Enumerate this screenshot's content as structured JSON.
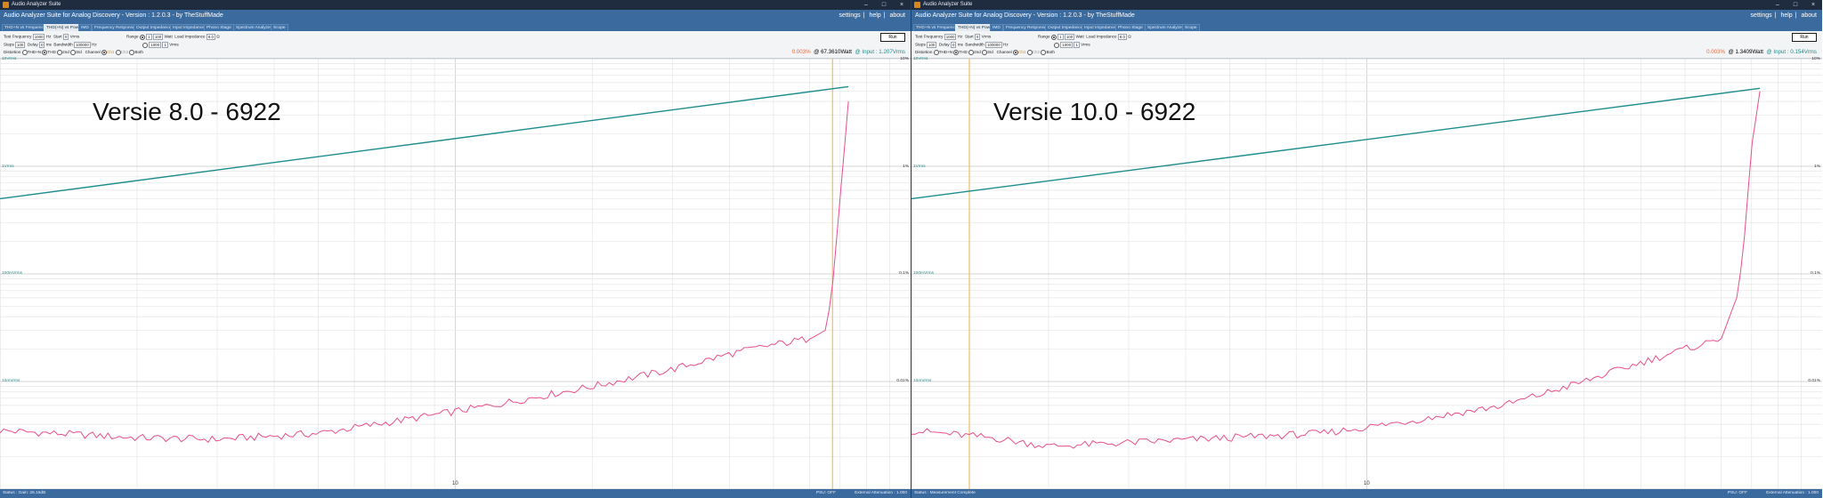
{
  "colors": {
    "titlebar": "#1f2c3f",
    "header": "#3a6a9e",
    "thd": "#e84f8c",
    "level": "#1f8c8c",
    "marker": "#f0b040"
  },
  "windows": [
    {
      "title": "Audio Analyzer Suite",
      "app_name": "Audio Analyzer Suite for Analog Discovery - Version : 1.2.0.3 - by TheStuffMade",
      "links": [
        "settings",
        "help",
        "about"
      ],
      "tabs": [
        "THD+N vs Frequency",
        "THD(+N) vs Power",
        "IMD",
        "Frequency Response",
        "Output Impedance",
        "Input Impedance",
        "Phono Stage",
        "Spectrum Analyzer",
        "Scope"
      ],
      "active_tab": 1,
      "controls": {
        "test_freq_label": "Test Frequency",
        "test_freq_value": "1000",
        "hz": "Hz",
        "start_label": "Start",
        "start_value": "0",
        "vrms": "Vrms",
        "range_label": "Range",
        "range_from": "1",
        "range_to": "100",
        "watt": "Watt",
        "load_label": "Load Impedance",
        "load_value": "8.0",
        "ohm": "Ω",
        "steps_label": "Steps",
        "steps_value": "100",
        "delay_label": "Delay",
        "delay_value": "0",
        "ms": "ms",
        "bandwidth_label": "Bandwidth",
        "bandwidth_value": "100000",
        "sub_from": "1000",
        "sub_to": "1",
        "sub_unit": "Vrms",
        "distortion_label": "Distortion",
        "dist_opts": [
          "THD+N",
          "THD",
          "2nd",
          "3rd"
        ],
        "channel_label": "Channel",
        "channel_opts": [
          "Ch1",
          "Ch2",
          "Both"
        ],
        "run": "Run"
      },
      "readout": {
        "thd": "0.003%",
        "power": "@ 67.3610Watt",
        "input": "@ Input : 1.207Vrms"
      },
      "version_label": "Versie 8.0 - 6922",
      "y_left": [
        "10Vrms",
        "1Vrms",
        "100mVrms",
        "10mVrms"
      ],
      "y_right": [
        "10%",
        "1%",
        "0.1%",
        "0.01%"
      ],
      "x_label": "10",
      "status_left": "Status : Gain: 26.15dB",
      "status_mid": "PSU: OFF",
      "status_right": "External Attenuation : 1.000"
    },
    {
      "title": "Audio Analyzer Suite",
      "app_name": "Audio Analyzer Suite for Analog Discovery - Version : 1.2.0.3 - by TheStuffMade",
      "links": [
        "settings",
        "help",
        "about"
      ],
      "tabs": [
        "THD+N vs Frequency",
        "THD(+N) vs Power",
        "IMD",
        "Frequency Response",
        "Output Impedance",
        "Input Impedance",
        "Phono Stage",
        "Spectrum Analyzer",
        "Scope"
      ],
      "active_tab": 1,
      "controls": {
        "test_freq_label": "Test Frequency",
        "test_freq_value": "1000",
        "hz": "Hz",
        "start_label": "Start",
        "start_value": "0",
        "vrms": "Vrms",
        "range_label": "Range",
        "range_from": "1",
        "range_to": "100",
        "watt": "Watt",
        "load_label": "Load Impedance",
        "load_value": "8.0",
        "ohm": "Ω",
        "steps_label": "Steps",
        "steps_value": "100",
        "delay_label": "Delay",
        "delay_value": "0",
        "ms": "ms",
        "bandwidth_label": "Bandwidth",
        "bandwidth_value": "100000",
        "sub_from": "1000",
        "sub_to": "1",
        "sub_unit": "Vrms",
        "distortion_label": "Distortion",
        "dist_opts": [
          "THD+N",
          "THD",
          "2nd",
          "3rd"
        ],
        "channel_label": "Channel",
        "channel_opts": [
          "Ch1",
          "Ch2",
          "Both"
        ],
        "run": "Run"
      },
      "readout": {
        "thd": "0.003%",
        "power": "@ 1.3409Watt",
        "input": "@ Input : 0.154Vrms"
      },
      "version_label": "Versie 10.0 - 6922",
      "y_left": [
        "10Vrms",
        "1Vrms",
        "100mVrms",
        "10mVrms"
      ],
      "y_right": [
        "10%",
        "1%",
        "0.1%",
        "0.01%"
      ],
      "x_label": "10",
      "status_left": "Status : Measurement Complete",
      "status_mid": "PSU: OFF",
      "status_right": "External Attenuation : 1.000"
    }
  ],
  "chart_data": [
    {
      "type": "line",
      "x_scale": "log",
      "x_unit": "Watt",
      "xlim": [
        1,
        100
      ],
      "series": [
        {
          "x": [
            1,
            1.5,
            2,
            3,
            5,
            8,
            12,
            20,
            30,
            40,
            50,
            60,
            65,
            67,
            70,
            73
          ],
          "y": [
            0.0035,
            0.0032,
            0.003,
            0.0029,
            0.0033,
            0.0045,
            0.006,
            0.009,
            0.013,
            0.018,
            0.022,
            0.025,
            0.03,
            0.06,
            0.5,
            4.0
          ]
        },
        {
          "x": [
            1,
            73
          ],
          "y": [
            0.5,
            5.5
          ]
        }
      ]
    },
    {
      "type": "line",
      "x_scale": "log",
      "x_unit": "Watt",
      "xlim": [
        1,
        100
      ],
      "series": [
        {
          "x": [
            1,
            1.5,
            2,
            3,
            5,
            8,
            12,
            20,
            30,
            40,
            50,
            60,
            65,
            67,
            70,
            73
          ],
          "y": [
            0.0035,
            0.003,
            0.0025,
            0.0027,
            0.003,
            0.0033,
            0.0042,
            0.006,
            0.01,
            0.015,
            0.02,
            0.025,
            0.06,
            0.15,
            1.5,
            5.0
          ]
        },
        {
          "x": [
            1,
            73
          ],
          "y": [
            0.5,
            5.3
          ]
        }
      ]
    }
  ]
}
